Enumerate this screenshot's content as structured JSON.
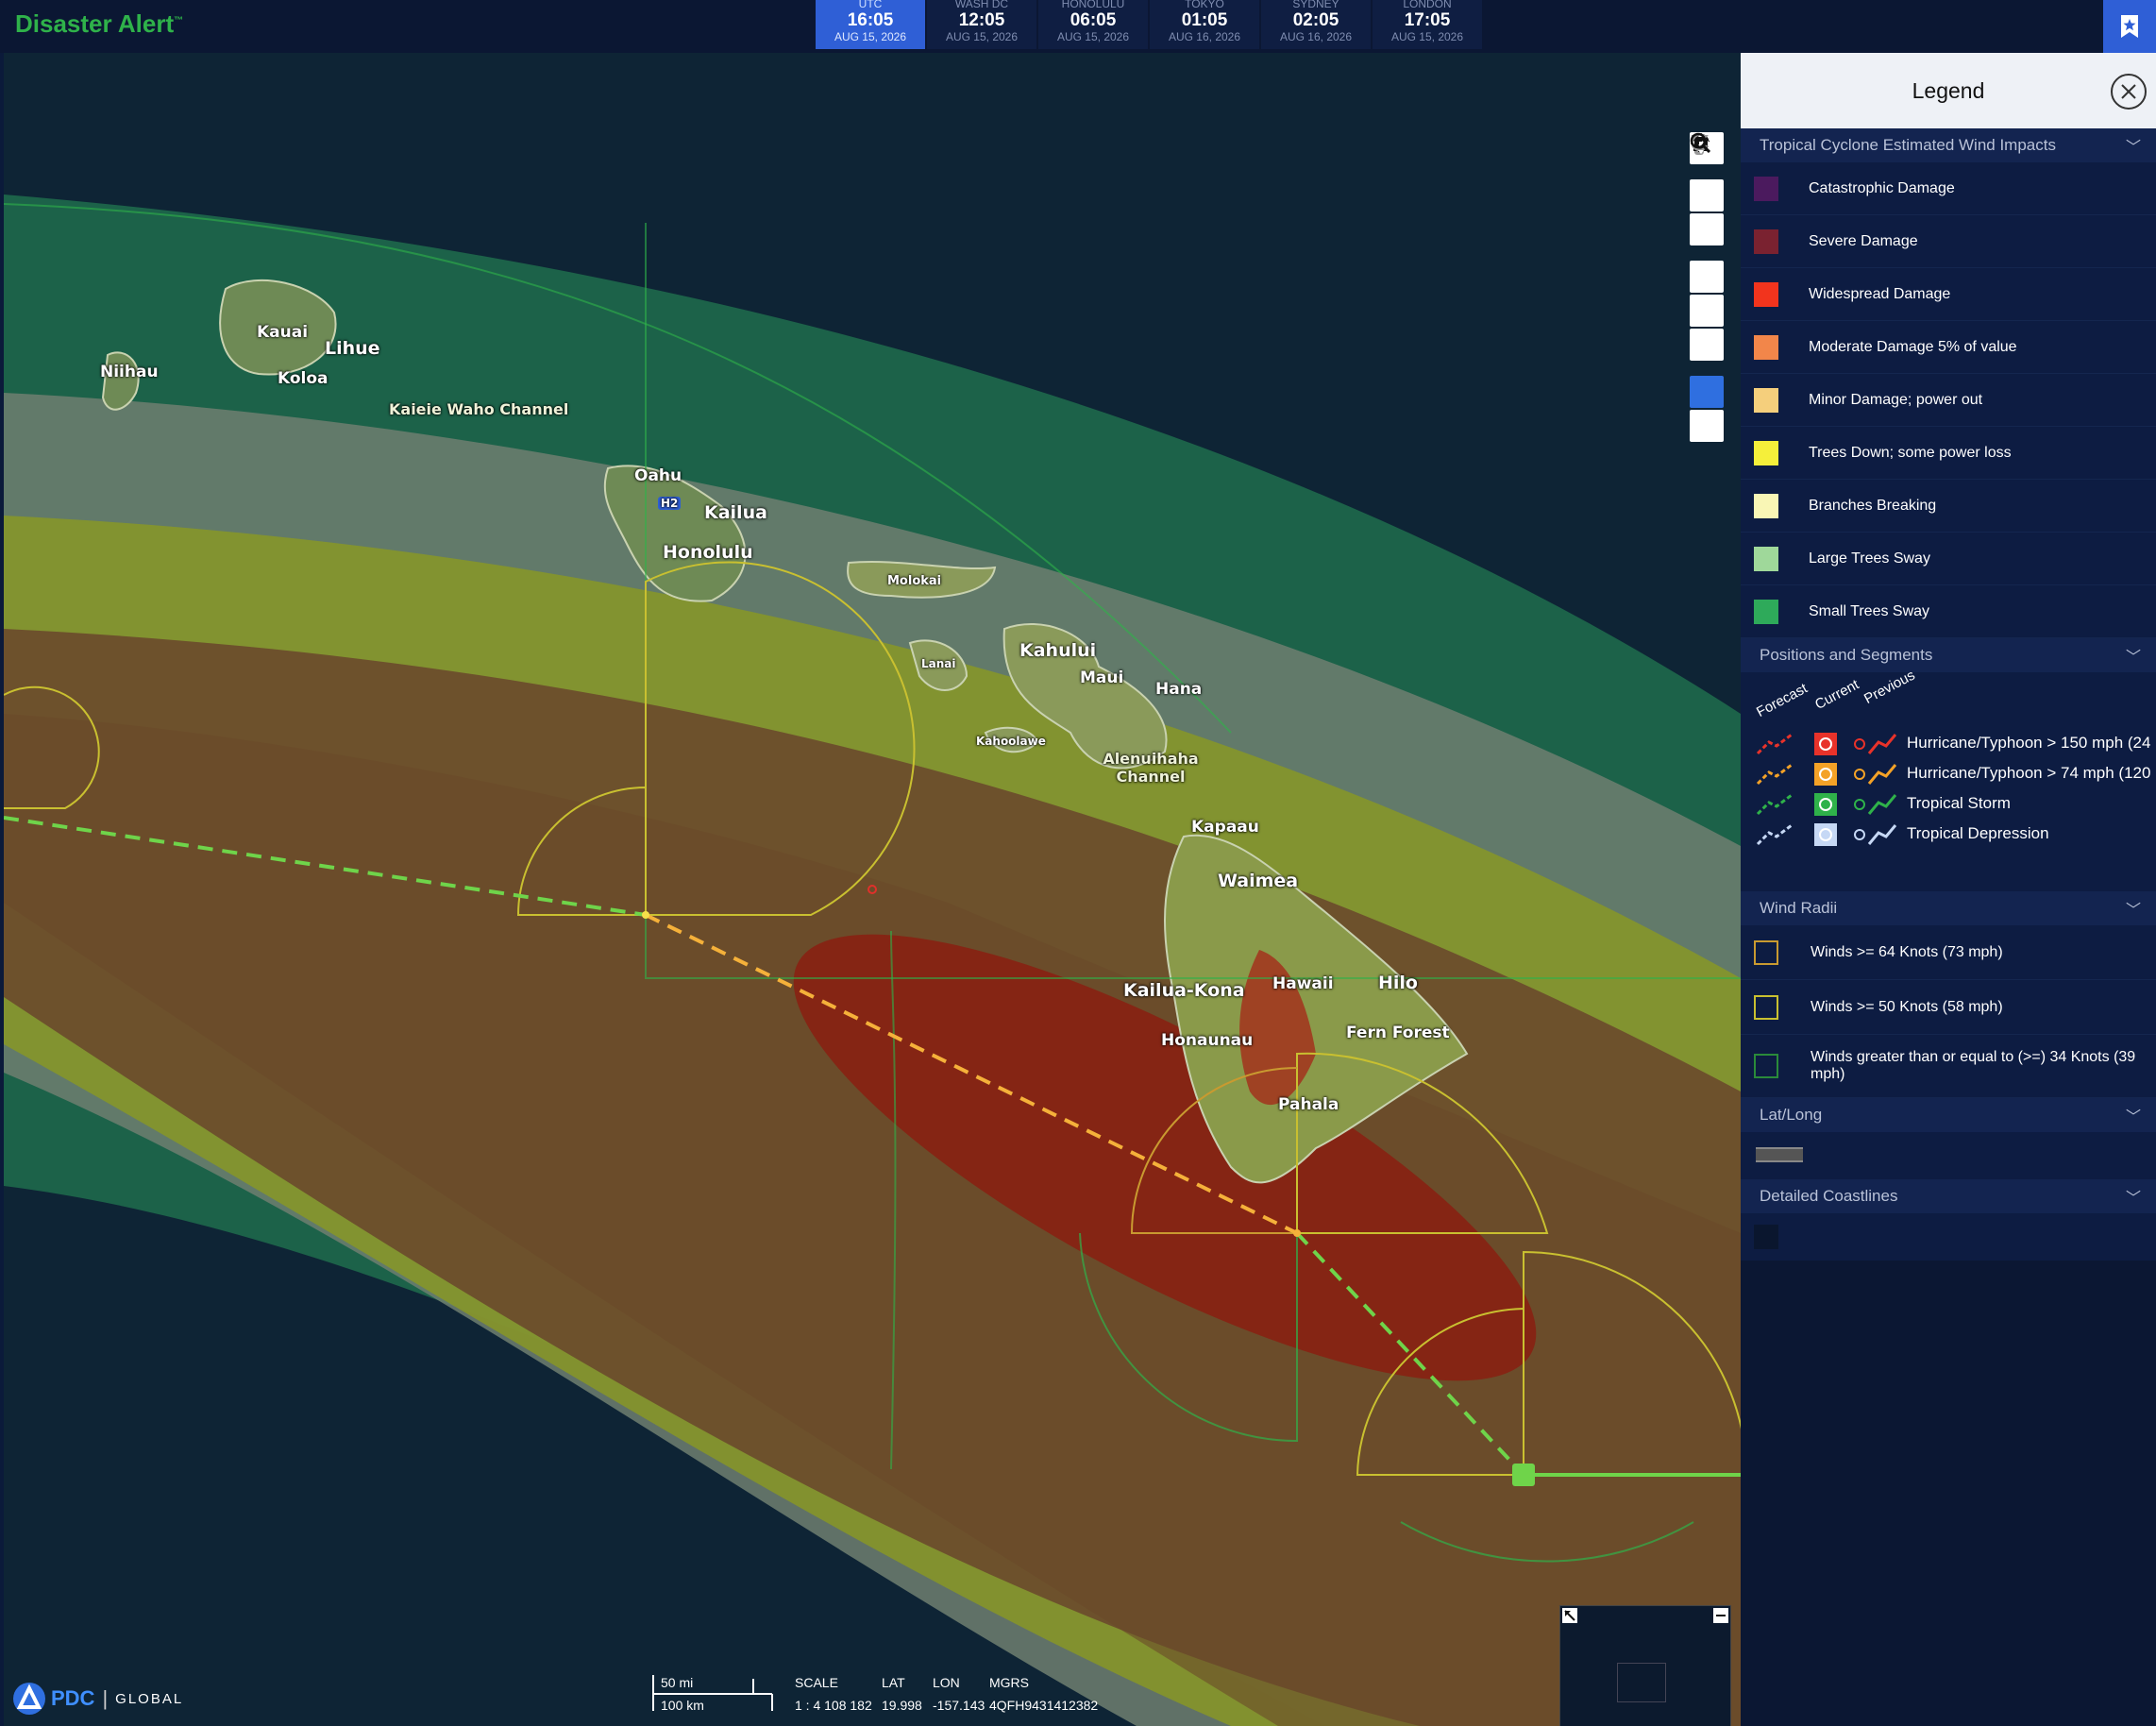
{
  "app": {
    "title": "Disaster Alert",
    "trademark": "™"
  },
  "clocks": [
    {
      "city": "UTC",
      "time": "16:05",
      "date": "AUG 15, 2026",
      "active": true
    },
    {
      "city": "WASH DC",
      "time": "12:05",
      "date": "AUG 15, 2026",
      "active": false
    },
    {
      "city": "HONOLULU",
      "time": "06:05",
      "date": "AUG 15, 2026",
      "active": false
    },
    {
      "city": "TOKYO",
      "time": "01:05",
      "date": "AUG 16, 2026",
      "active": false
    },
    {
      "city": "SYDNEY",
      "time": "02:05",
      "date": "AUG 16, 2026",
      "active": false
    },
    {
      "city": "LONDON",
      "time": "17:05",
      "date": "AUG 15, 2026",
      "active": false
    }
  ],
  "map": {
    "places": {
      "kauai": "Kauai",
      "lihue": "Lihue",
      "koloa": "Koloa",
      "niihau": "Niihau",
      "kaieie": "Kaieie Waho Channel",
      "oahu": "Oahu",
      "kailua": "Kailua",
      "honolulu": "Honolulu",
      "h2": "H2",
      "molokai": "Molokai",
      "lanai": "Lanai",
      "kahului": "Kahului",
      "maui": "Maui",
      "hana": "Hana",
      "kahoolawe": "Kahoolawe",
      "alenuihaha": "Alenuihaha Channel",
      "kapaau": "Kapaau",
      "waimea": "Waimea",
      "kailuakona": "Kailua-Kona",
      "hawaii": "Hawaii",
      "hilo": "Hilo",
      "honaunau": "Honaunau",
      "fernforest": "Fern Forest",
      "pahala": "Pahala"
    },
    "impact_colors": {
      "outer_green": "#1f6d4c",
      "light_gray": "#7a8a7a",
      "yellow_green": "#8a9a1a",
      "brown": "#6b4a2a",
      "dark_red": "#8a1e10"
    },
    "track_colors": {
      "past": "#6fd44a",
      "forecast": "#f5b13a"
    }
  },
  "tools": [
    {
      "icon": "person-icon"
    },
    {
      "icon": "zoom-in-icon"
    },
    {
      "icon": "zoom-out-icon"
    },
    {
      "icon": "home-icon"
    },
    {
      "icon": "rotate-left-icon"
    },
    {
      "icon": "rotate-right-icon"
    },
    {
      "icon": "pan-icon"
    },
    {
      "icon": "zoom-box-icon"
    }
  ],
  "legend": {
    "title": "Legend",
    "sections": {
      "wind_impacts": "Tropical Cyclone Estimated Wind Impacts",
      "positions": "Positions and Segments",
      "wind_radii": "Wind Radii",
      "latlong": "Lat/Long",
      "coastlines": "Detailed Coastlines"
    },
    "impacts": [
      {
        "label": "Catastrophic Damage",
        "color": "#4b1a5e"
      },
      {
        "label": "Severe Damage",
        "color": "#7a2230"
      },
      {
        "label": "Widespread Damage",
        "color": "#f2341d"
      },
      {
        "label": "Moderate Damage 5% of value",
        "color": "#f2864a"
      },
      {
        "label": "Minor Damage; power out",
        "color": "#f5cf7c"
      },
      {
        "label": "Trees Down; some power loss",
        "color": "#f5ef3a"
      },
      {
        "label": "Branches Breaking",
        "color": "#f9f6b5"
      },
      {
        "label": "Large Trees Sway",
        "color": "#9fd89a"
      },
      {
        "label": "Small Trees Sway",
        "color": "#2eaa5a"
      }
    ],
    "positions_header": {
      "forecast": "Forecast",
      "current": "Current",
      "previous": "Previous"
    },
    "positions": [
      {
        "label": "Hurricane/Typhoon > 150 mph (24",
        "color": "#e8322a"
      },
      {
        "label": "Hurricane/Typhoon > 74 mph (120",
        "color": "#f4a227"
      },
      {
        "label": "Tropical Storm",
        "color": "#2fb24a"
      },
      {
        "label": "Tropical Depression",
        "color": "#c6d8f5"
      }
    ],
    "radii": [
      {
        "label": "Winds >= 64 Knots (73 mph)",
        "color": "#c99a30"
      },
      {
        "label": "Winds >= 50 Knots (58 mph)",
        "color": "#c9c030"
      },
      {
        "label": "Winds greater than or equal to (>=) 34 Knots (39 mph)",
        "color": "#2a8a3a"
      }
    ]
  },
  "status": {
    "scale_mi": "50 mi",
    "scale_km": "100 km",
    "scale_label": "SCALE",
    "scale_value": "1 : 4 108 182",
    "lat_label": "LAT",
    "lat_value": "19.998",
    "lon_label": "LON",
    "lon_value": "-157.143",
    "mgrs_label": "MGRS",
    "mgrs_value": "4QFH9431412382"
  },
  "logo": {
    "pdc": "PDC",
    "global": "GLOBAL"
  }
}
